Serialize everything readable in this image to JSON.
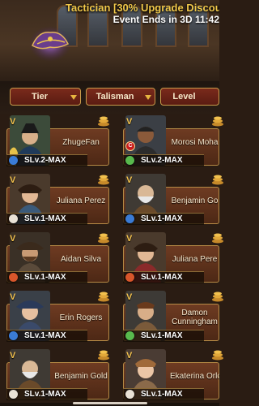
{
  "event": {
    "title": "Tactician [30% Upgrade Discou",
    "timer": "Event Ends in 3D 11:42"
  },
  "filters": {
    "tier": "Tier",
    "talisman": "Talisman",
    "level": "Level"
  },
  "cards": [
    {
      "name": "ZhugeFan",
      "level": "SLv.2-MAX",
      "orb": "#3a7bd5"
    },
    {
      "name": "Morosi Moha",
      "level": "SLv.2-MAX",
      "orb": "#58b94d"
    },
    {
      "name": "Juliana Perez",
      "level": "SLv.1-MAX",
      "orb": "#e9e2d6"
    },
    {
      "name": "Benjamin Go",
      "level": "SLv.1-MAX",
      "orb": "#3a7bd5"
    },
    {
      "name": "Aidan Silva",
      "level": "SLv.1-MAX",
      "orb": "#d8562b"
    },
    {
      "name": "Juliana Pere",
      "level": "SLv.1-MAX",
      "orb": "#d8562b"
    },
    {
      "name": "Erin Rogers",
      "level": "SLv.1-MAX",
      "orb": "#3a7bd5"
    },
    {
      "name": "Damon Cunningham",
      "level": "SLv.1-MAX",
      "orb": "#58b94d"
    },
    {
      "name": "Benjamin Gold",
      "level": "SLv.1-MAX",
      "orb": "#e9e2d6"
    },
    {
      "name": "Ekaterina Orlo",
      "level": "SLv.1-MAX",
      "orb": "#e9e2d6"
    }
  ],
  "badge": "C",
  "vmark": "V"
}
